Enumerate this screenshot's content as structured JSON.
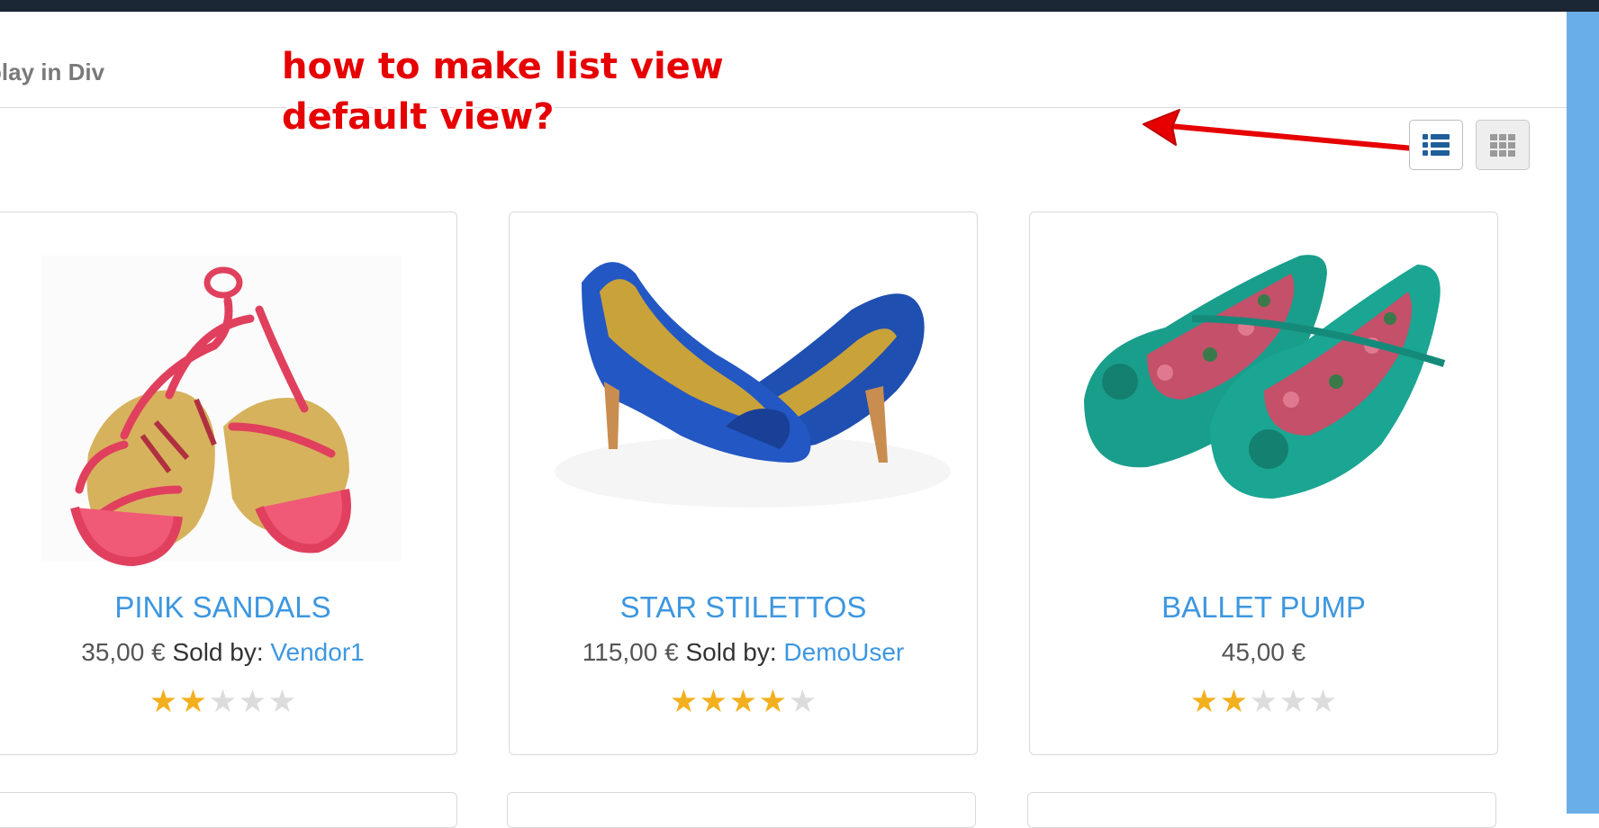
{
  "page": {
    "title": "play in Div"
  },
  "annotation": {
    "line1": "how to make list view",
    "line2": "default view?",
    "color": "#e60000"
  },
  "view_toggle": {
    "list_icon": "list-view-icon",
    "grid_icon": "grid-view-icon",
    "active": "list"
  },
  "products": [
    {
      "name": "PINK SANDALS",
      "price": "35,00 €",
      "sold_by_label": "Sold by:",
      "vendor": "Vendor1",
      "rating": 2,
      "max_rating": 5
    },
    {
      "name": "STAR STILETTOS",
      "price": "115,00 €",
      "sold_by_label": "Sold by:",
      "vendor": "DemoUser",
      "rating": 4,
      "max_rating": 5
    },
    {
      "name": "BALLET PUMP",
      "price": "45,00 €",
      "sold_by_label": "",
      "vendor": "",
      "rating": 2,
      "max_rating": 5
    }
  ],
  "colors": {
    "link": "#3d97e0",
    "star_on": "#f2b01e",
    "star_off": "#dcdcdc",
    "topbar": "#1b2735",
    "side_strip": "#6aaee8"
  }
}
